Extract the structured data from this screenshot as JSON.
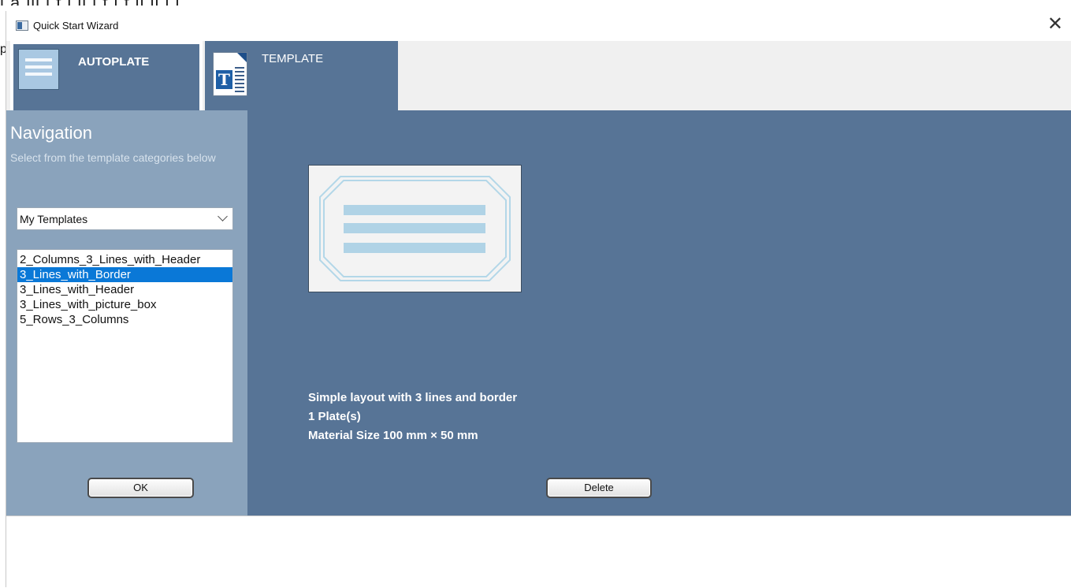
{
  "window": {
    "title": "Quick Start Wizard"
  },
  "tabs": {
    "autoplate": {
      "label": "AUTOPLATE"
    },
    "template": {
      "label": "TEMPLATE"
    }
  },
  "navigation": {
    "title": "Navigation",
    "subtitle": "Select from the template categories below",
    "category_select": {
      "value": "My Templates"
    },
    "templates": [
      {
        "label": "2_Columns_3_Lines_with_Header",
        "selected": false
      },
      {
        "label": "3_Lines_with_Border",
        "selected": true
      },
      {
        "label": "3_Lines_with_Header",
        "selected": false
      },
      {
        "label": "3_Lines_with_picture_box",
        "selected": false
      },
      {
        "label": "5_Rows_3_Columns",
        "selected": false
      }
    ],
    "ok_label": "OK"
  },
  "details": {
    "description": "Simple layout with 3 lines and border",
    "plates": "1 Plate(s)",
    "material": "Material Size 100 mm × 50 mm",
    "delete_label": "Delete"
  },
  "icons": {
    "app": "wizard-app-icon",
    "close": "close-icon",
    "autoplate": "autoplate-icon",
    "template": "template-icon",
    "dropdown": "chevron-down-icon"
  },
  "colors": {
    "panel": "#577496",
    "nav_panel": "#8aa3bc",
    "selection": "#0a78d7",
    "preview_lines": "#b0d3e6"
  }
}
